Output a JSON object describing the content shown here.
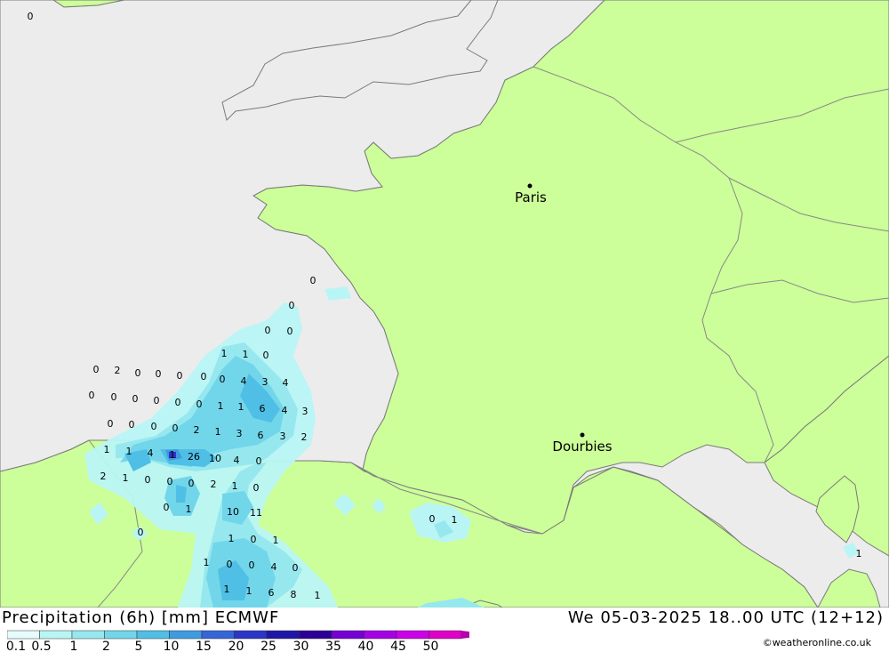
{
  "map": {
    "title": "Precipitation (6h) [mm] ECMWF",
    "datetime": "We 05-03-2025 18..00 UTC (12+12)",
    "credit": "©weatheronline.co.uk",
    "cities": [
      {
        "name": "Paris",
        "label": "Paris"
      },
      {
        "name": "Dourbies",
        "label": "Dourbies"
      }
    ],
    "precip_values": [
      "0",
      "0",
      "0",
      "0",
      "0",
      "0",
      "2",
      "0",
      "0",
      "0",
      "0",
      "1",
      "1",
      "0",
      "0",
      "4",
      "3",
      "4",
      "0",
      "0",
      "0",
      "0",
      "0",
      "0",
      "1",
      "1",
      "6",
      "4",
      "3",
      "0",
      "0",
      "0",
      "0",
      "2",
      "1",
      "3",
      "6",
      "3",
      "2",
      "1",
      "1",
      "4",
      "1",
      "26",
      "10",
      "4",
      "0",
      "2",
      "1",
      "0",
      "0",
      "0",
      "2",
      "1",
      "0",
      "0",
      "1",
      "10",
      "11",
      "0",
      "1",
      "0",
      "1",
      "1",
      "0",
      "0",
      "4",
      "0",
      "1",
      "1",
      "6",
      "8",
      "1",
      "0",
      "1",
      "1",
      "0",
      "0"
    ],
    "colors": {
      "sea": "#ececec",
      "land": "#ccff99",
      "border": "#888888",
      "coast": "#7a7a7a"
    }
  },
  "legend": {
    "ticks": [
      "0.1",
      "0.5",
      "1",
      "2",
      "5",
      "10",
      "15",
      "20",
      "25",
      "30",
      "35",
      "40",
      "45",
      "50"
    ],
    "colors": [
      "#e6fcfc",
      "#b9f5f5",
      "#96e8ee",
      "#72d6ea",
      "#4fbfe5",
      "#3f9be0",
      "#3565d8",
      "#2b35c8",
      "#1f16a8",
      "#2c0097",
      "#7400d6",
      "#a600e6",
      "#cc00ea",
      "#e100c8",
      "#b400a8"
    ]
  }
}
